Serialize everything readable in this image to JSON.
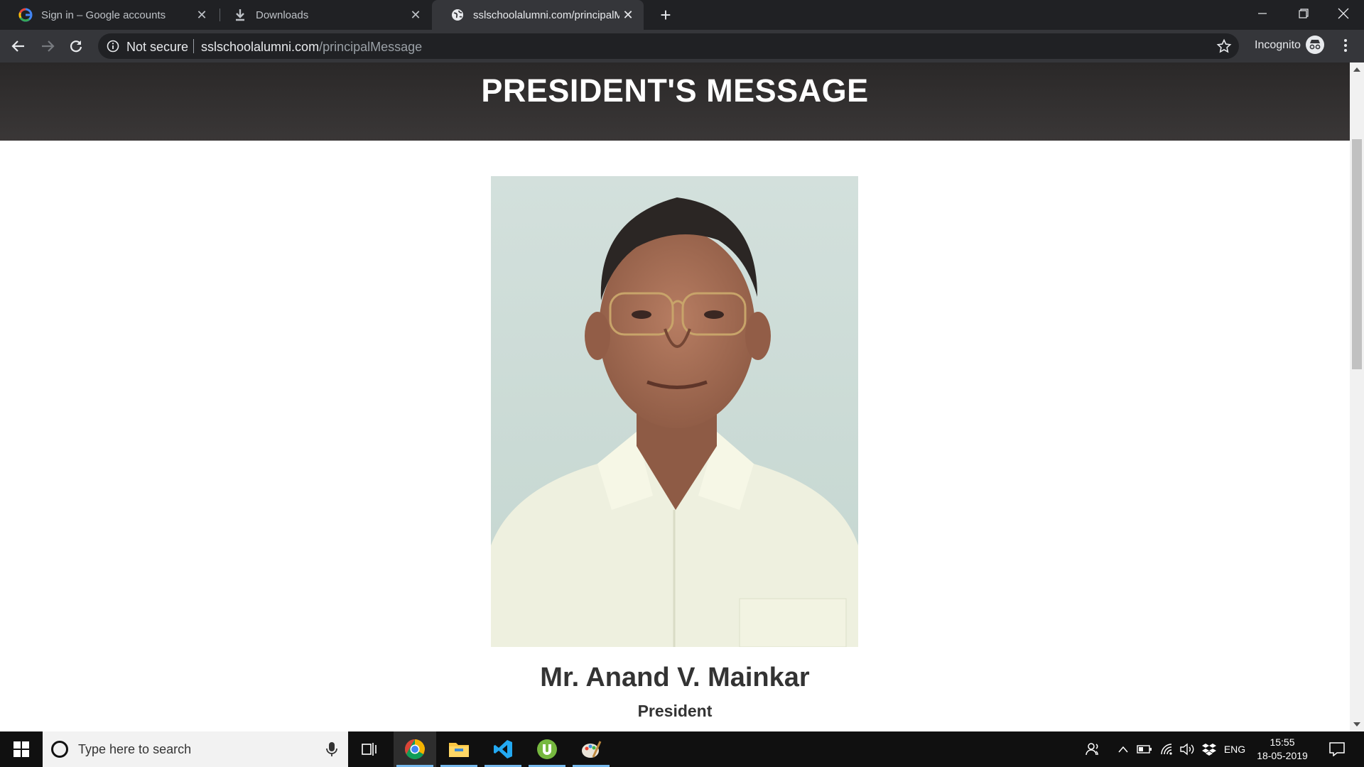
{
  "browser": {
    "tabs": [
      {
        "label": "Sign in – Google accounts",
        "icon": "google-icon",
        "active": false
      },
      {
        "label": "Downloads",
        "icon": "download-icon",
        "active": false
      },
      {
        "label": "sslschoolalumni.com/principalMe",
        "icon": "globe-icon",
        "active": true
      }
    ],
    "security_label": "Not secure",
    "url_host": "sslschoolalumni.com",
    "url_path": "/principalMessage",
    "incognito_label": "Incognito"
  },
  "page": {
    "title": "PRESIDENT'S MESSAGE",
    "person_name": "Mr. Anand V. Mainkar",
    "person_role": "President"
  },
  "taskbar": {
    "search_placeholder": "Type here to search",
    "apps": [
      "chrome-icon",
      "file-explorer-icon",
      "vscode-icon",
      "utorrent-icon",
      "paint-icon"
    ],
    "language": "ENG",
    "time": "15:55",
    "date": "18-05-2019"
  },
  "colors": {
    "header_bg": "#2f2d2d",
    "chrome_dark": "#202124",
    "chrome_toolbar": "#35363a",
    "taskbar_bg": "#101010"
  }
}
